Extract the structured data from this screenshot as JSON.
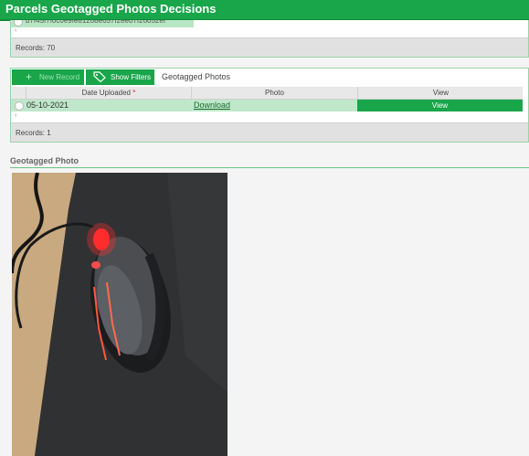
{
  "header": {
    "title": "Parcels Geotagged Photos Decisions"
  },
  "previous_panel": {
    "row_partial_text": "b7f45f7f0c0e9fe81208e657f2ee07f26052ef",
    "scroll_left": "‹",
    "records_text": "Records: 70"
  },
  "main_panel": {
    "toolbar": {
      "new_record_label": "New Record",
      "new_record_icon": "plus-icon",
      "show_filters_label": "Show Filters",
      "show_filters_icon": "tag-icon",
      "tab_label": "Geotagged Photos"
    },
    "columns": [
      {
        "label": "Date Uploaded",
        "required": "*"
      },
      {
        "label": "Photo"
      },
      {
        "label": "View"
      }
    ],
    "rows": [
      {
        "date": "05-10-2021",
        "photo": "Download",
        "view": "View"
      }
    ],
    "scroll_left": "‹",
    "records_text": "Records: 1"
  },
  "photo_section": {
    "title": "Geotagged Photo"
  },
  "colors": {
    "brand_green": "#19a64a",
    "row_highlight": "#bfe8cb",
    "panel_border": "#9bd4a8"
  }
}
